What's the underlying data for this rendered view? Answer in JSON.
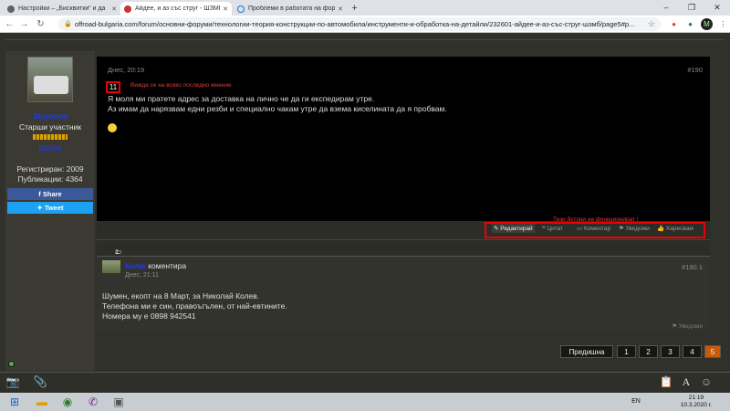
{
  "browser": {
    "tabs": [
      {
        "title": "Настройки – „Бисквитки“ и да",
        "active": false
      },
      {
        "title": "Айдее, и аз със струг - ШЗМБ",
        "active": true
      },
      {
        "title": "Проблеми в работата на форум",
        "active": false
      }
    ],
    "new_tab": "+",
    "url": "offroad-bulgaria.com/forum/основни-форуми/технологии-теория-конструкции-по-автомобила/инструменти-и-обработка-на-детайли/232601-айдее-и-аз-със-струг-шзмб/page5#p..."
  },
  "author": {
    "name": "Stoyanov",
    "title": "Старши участник",
    "badge": "ШЗМБ",
    "registered": "Регистриран: 2009",
    "posts": "Публикации: 4364",
    "share": "Share",
    "tweet": "Tweet"
  },
  "post": {
    "date": "Днес, 20:19",
    "number": "#190",
    "quote_count": "11",
    "note_top": "Вижда се на всяко последно мнение",
    "lines": [
      "Я моля ми пратете адрес за доставка на лично че да ги експедирам утре.",
      "Аз имам да нарязвам едни резби и специално чакам утре да взема киселината да я пробвам."
    ],
    "note_buttons": "Тези бутони не функционират !",
    "actions": {
      "edit": "Редактирай",
      "quote": "Цитат",
      "comment": "Коментар",
      "notify": "Уведоми",
      "like": "Харесвам"
    }
  },
  "comments_header": "1 коментар",
  "comment": {
    "user": "Колю",
    "verb": "коментира",
    "date": "Днес, 21:11",
    "number": "#190.1",
    "lines": [
      "Шумен, екопт на 8 Март, за Николай Колев.",
      "Телефона ми е син, правоъгълен, от най-евтините.",
      "Номера му е 0898 942541"
    ],
    "report": "Уведоми"
  },
  "pagination": {
    "prev": "Предишна",
    "pages": [
      "1",
      "2",
      "3",
      "4",
      "5"
    ],
    "current": "5"
  },
  "taskbar": {
    "lang": "EN",
    "time": "21:19",
    "date": "10.3.2020 г."
  },
  "colors": {
    "accent_current_page": "#c95a0a",
    "username": "#1f38ff",
    "annotation": "#e00000"
  }
}
